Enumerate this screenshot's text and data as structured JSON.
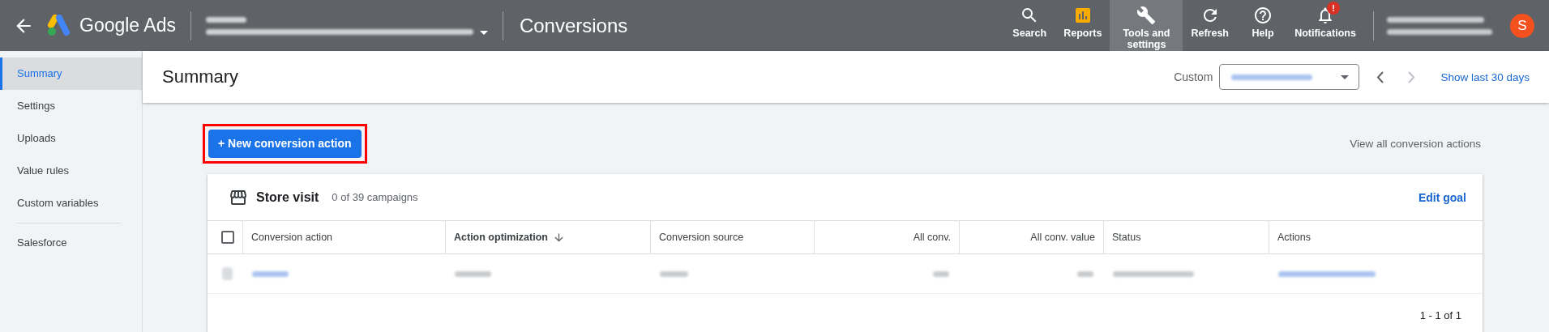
{
  "top_bar": {
    "product": "Google Ads",
    "page_title": "Conversions",
    "nav": [
      {
        "kind": "search",
        "label": "Search",
        "selected": false
      },
      {
        "kind": "reports",
        "label": "Reports",
        "selected": false
      },
      {
        "kind": "tools",
        "label": "Tools and settings",
        "selected": true
      },
      {
        "kind": "refresh",
        "label": "Refresh",
        "selected": false
      },
      {
        "kind": "help",
        "label": "Help",
        "selected": false
      },
      {
        "kind": "notifications",
        "label": "Notifications",
        "selected": false,
        "badge": "!"
      }
    ],
    "avatar": "S"
  },
  "sidebar": {
    "sections": [
      {
        "items": [
          {
            "label": "Summary",
            "selected": true
          },
          {
            "label": "Settings",
            "selected": false
          },
          {
            "label": "Uploads",
            "selected": false
          },
          {
            "label": "Value rules",
            "selected": false
          },
          {
            "label": "Custom variables",
            "selected": false
          }
        ]
      },
      {
        "items": [
          {
            "label": "Salesforce",
            "selected": false
          }
        ]
      }
    ]
  },
  "header": {
    "title": "Summary",
    "range_label": "Custom",
    "prev_disabled": false,
    "next_disabled": true,
    "show_last": "Show last 30 days"
  },
  "actions": {
    "new_button": "+ New conversion action",
    "highlighted": true,
    "view_all": "View all conversion actions"
  },
  "card": {
    "title": "Store visit",
    "subtitle": "0 of 39 campaigns",
    "edit": "Edit goal",
    "table": {
      "select_all_checked": false,
      "columns": [
        {
          "label": "Conversion action",
          "numeric": false,
          "sorted": false
        },
        {
          "label": "Action optimization",
          "numeric": false,
          "sorted": true
        },
        {
          "label": "Conversion source",
          "numeric": false,
          "sorted": false
        },
        {
          "label": "All conv.",
          "numeric": true,
          "sorted": false
        },
        {
          "label": "All conv. value",
          "numeric": true,
          "sorted": false
        },
        {
          "label": "Status",
          "numeric": false,
          "sorted": false
        },
        {
          "label": "Actions",
          "numeric": false,
          "sorted": false
        }
      ]
    },
    "pagination": "1 - 1 of 1"
  }
}
